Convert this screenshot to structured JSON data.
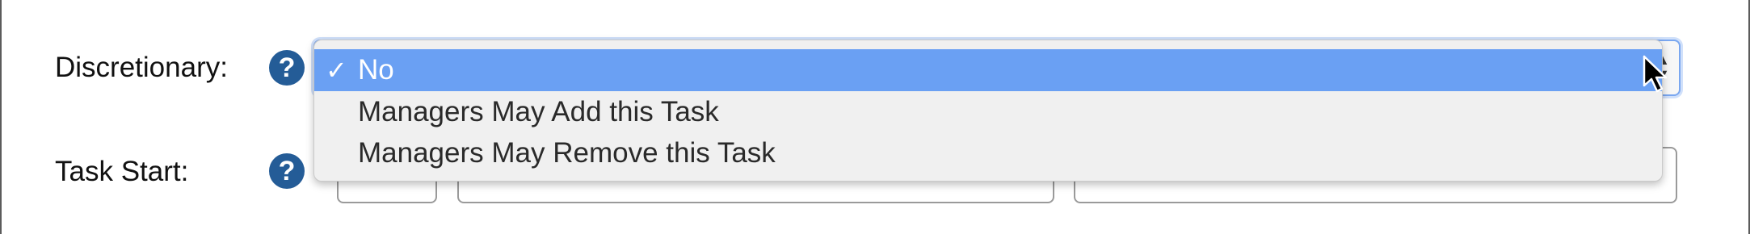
{
  "form": {
    "discretionary": {
      "label": "Discretionary:",
      "help": "?",
      "selected": "No",
      "options": [
        {
          "label": "No",
          "selected": true,
          "check": "✓"
        },
        {
          "label": "Managers May Add this Task",
          "selected": false
        },
        {
          "label": "Managers May Remove this Task",
          "selected": false
        }
      ]
    },
    "task_start": {
      "label": "Task Start:",
      "help": "?"
    }
  },
  "colors": {
    "help_icon": "#245c97",
    "highlight": "#6aa0f3",
    "popup_bg": "#f0f0f0"
  },
  "icons": {
    "help": "question-circle-icon",
    "check": "checkmark-icon",
    "updown": "select-arrows-icon",
    "cursor": "mouse-pointer-icon"
  }
}
